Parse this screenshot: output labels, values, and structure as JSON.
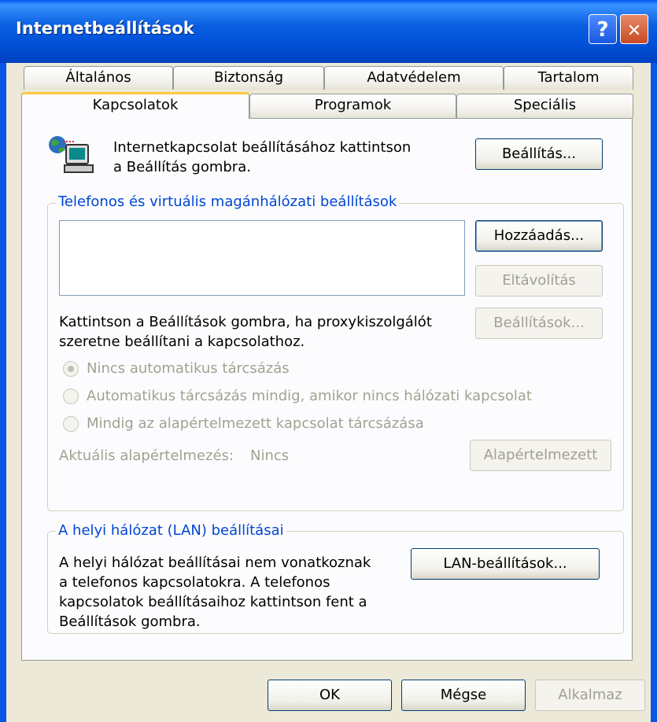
{
  "window": {
    "title": "Internetbeállítások",
    "help_glyph": "?",
    "close_glyph": "✕"
  },
  "tabs": {
    "row1": [
      "Általános",
      "Biztonság",
      "Adatvédelem",
      "Tartalom"
    ],
    "row2": [
      "Kapcsolatok",
      "Programok",
      "Speciális"
    ],
    "active": "Kapcsolatok"
  },
  "setup": {
    "text_line1": "Internetkapcsolat beállításához kattintson",
    "text_line2": "a Beállítás gombra.",
    "button": "Beállítás...",
    "icon": "network-computer-icon"
  },
  "dialup": {
    "legend": "Telefonos és virtuális magánhálózati beállítások",
    "add_button": "Hozzáadás...",
    "remove_button": "Eltávolítás",
    "proxy_text_line1": "Kattintson a Beállítások gombra, ha proxykiszolgálót",
    "proxy_text_line2": "szeretne beállítani a kapcsolathoz.",
    "settings_button": "Beállítások...",
    "radios": [
      {
        "label": "Nincs automatikus tárcsázás",
        "selected": true
      },
      {
        "label": "Automatikus tárcsázás mindig, amikor nincs hálózati kapcsolat",
        "selected": false
      },
      {
        "label": "Mindig az alapértelmezett kapcsolat tárcsázása",
        "selected": false
      }
    ],
    "current_default_label": "Aktuális alapértelmezés:",
    "current_default_value": "Nincs",
    "default_button": "Alapértelmezett"
  },
  "lan": {
    "legend": "A helyi hálózat (LAN) beállításai",
    "text_lines": [
      "A helyi hálózat beállításai nem vonatkoznak",
      "a telefonos kapcsolatokra. A telefonos",
      "kapcsolatok beállításaihoz kattintson fent a",
      "Beállítások gombra."
    ],
    "button": "LAN-beállítások..."
  },
  "footer": {
    "ok": "OK",
    "cancel": "Mégse",
    "apply": "Alkalmaz"
  }
}
